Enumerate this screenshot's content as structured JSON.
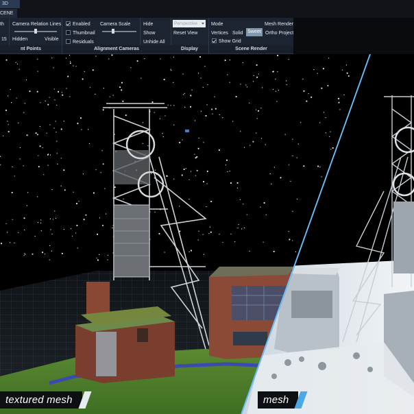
{
  "top_tabs": {
    "tab_3d": "3D",
    "tab_scene": "CENE"
  },
  "ribbon": {
    "points_group": {
      "label": "nt Points",
      "left_top": "th",
      "value": "15"
    },
    "camera_relation": {
      "title": "Camera Relation Lines",
      "left": "Hidden",
      "right": "Visible"
    },
    "alignment_cameras": {
      "label": "Alignment Cameras",
      "enabled": "Enabled",
      "thumbnail": "Thumbnail",
      "residuals": "Residuals",
      "camera_scale": "Camera Scale",
      "hide": "Hide",
      "show": "Show",
      "unhide_all": "Unhide All"
    },
    "display": {
      "label": "Display",
      "projection": "Perspective",
      "reset_view": "Reset View"
    },
    "scene_render": {
      "label": "Scene Render",
      "mode": "Mode",
      "vertices": "Vertices",
      "solid": "Solid",
      "sweet": "Sweet",
      "mesh_render": "Mesh Render",
      "ortho_project": "Ortho Project",
      "show_grid": "Show Grid"
    }
  },
  "viewport": {
    "left_label": "textured mesh",
    "right_label": "mesh",
    "divider_color": "#4aa8e8",
    "background": "#000000"
  }
}
